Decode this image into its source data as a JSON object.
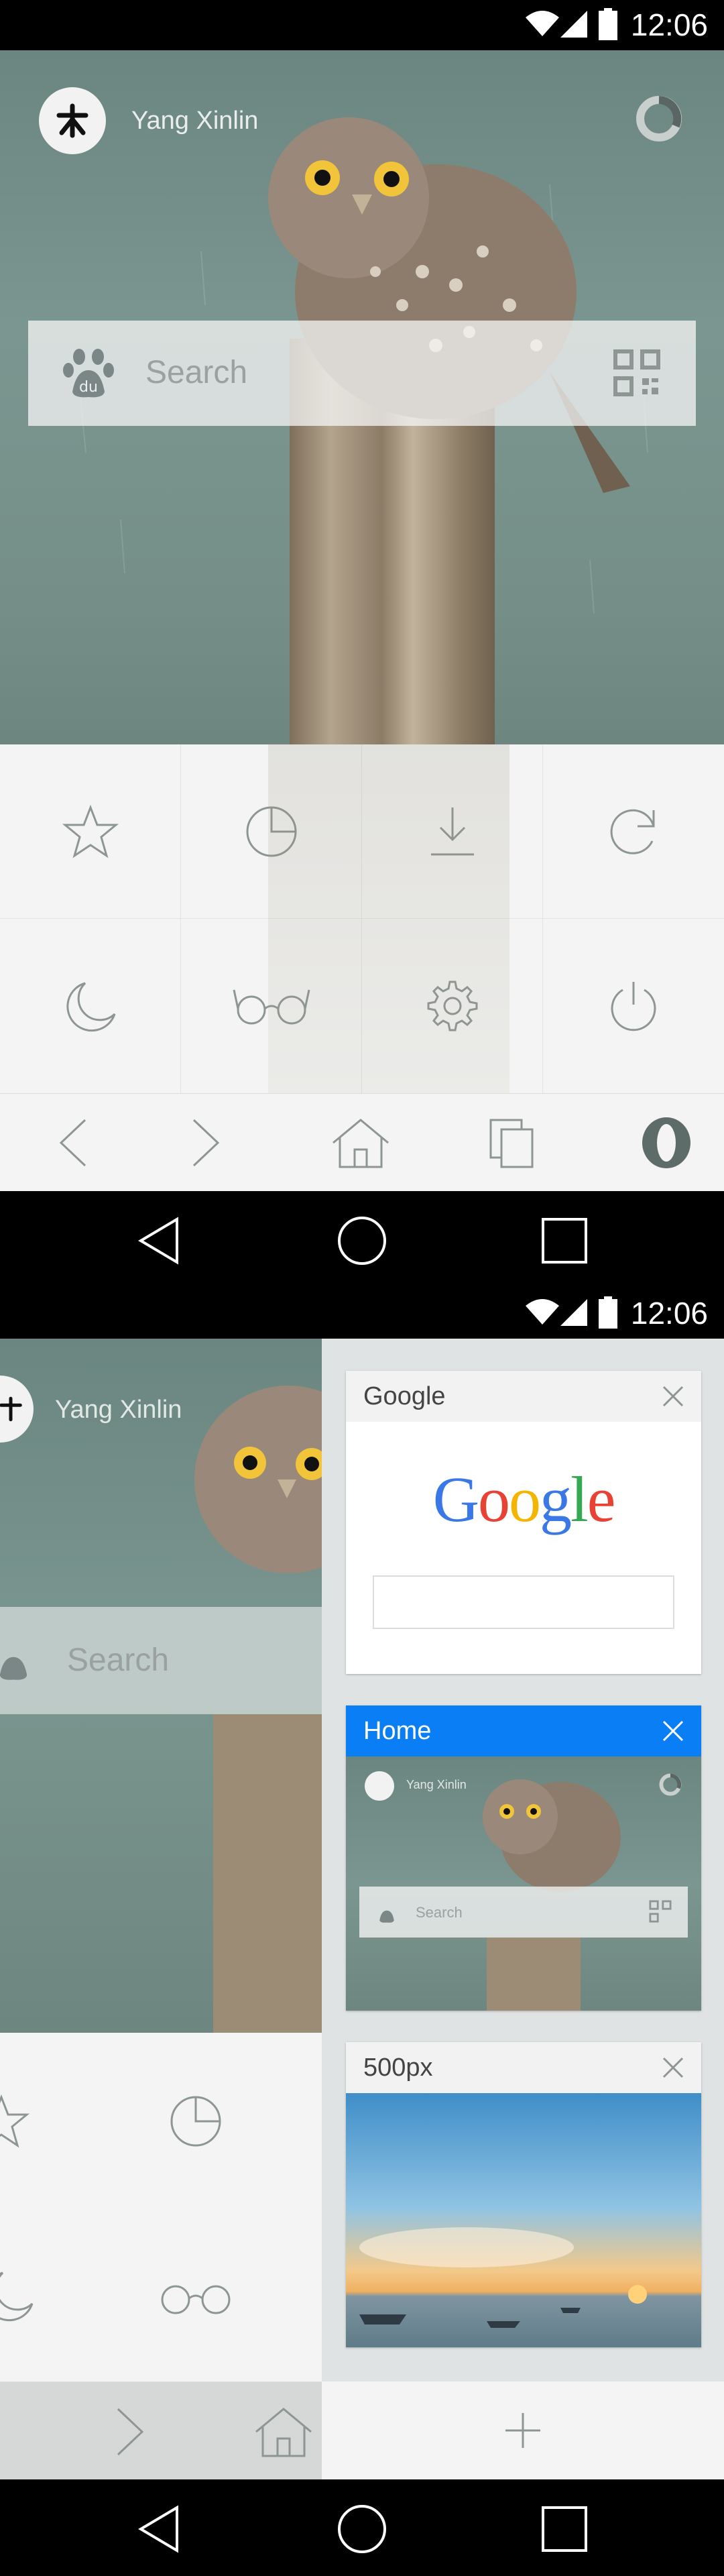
{
  "status": {
    "time": "12:06"
  },
  "home": {
    "profile_name": "Yang Xinlin",
    "search_placeholder": "Search",
    "grid_icons": [
      "star-icon",
      "pie-chart-icon",
      "download-icon",
      "refresh-icon",
      "moon-icon",
      "glasses-icon",
      "gear-icon",
      "power-icon"
    ],
    "toolbar_icons": [
      "back-icon",
      "forward-icon",
      "home-icon",
      "tabs-icon",
      "opera-icon"
    ]
  },
  "switcher": {
    "tabs": [
      {
        "title": "Google",
        "logo_text": "Google",
        "active": false
      },
      {
        "title": "Home",
        "active": true,
        "preview_name": "Yang Xinlin",
        "preview_search": "Search"
      },
      {
        "title": "500px",
        "active": false
      }
    ],
    "add_label": "+"
  },
  "colors": {
    "accent": "#0a7ff5",
    "icon_stroke": "#8e9694",
    "hero": "#7b9690"
  }
}
